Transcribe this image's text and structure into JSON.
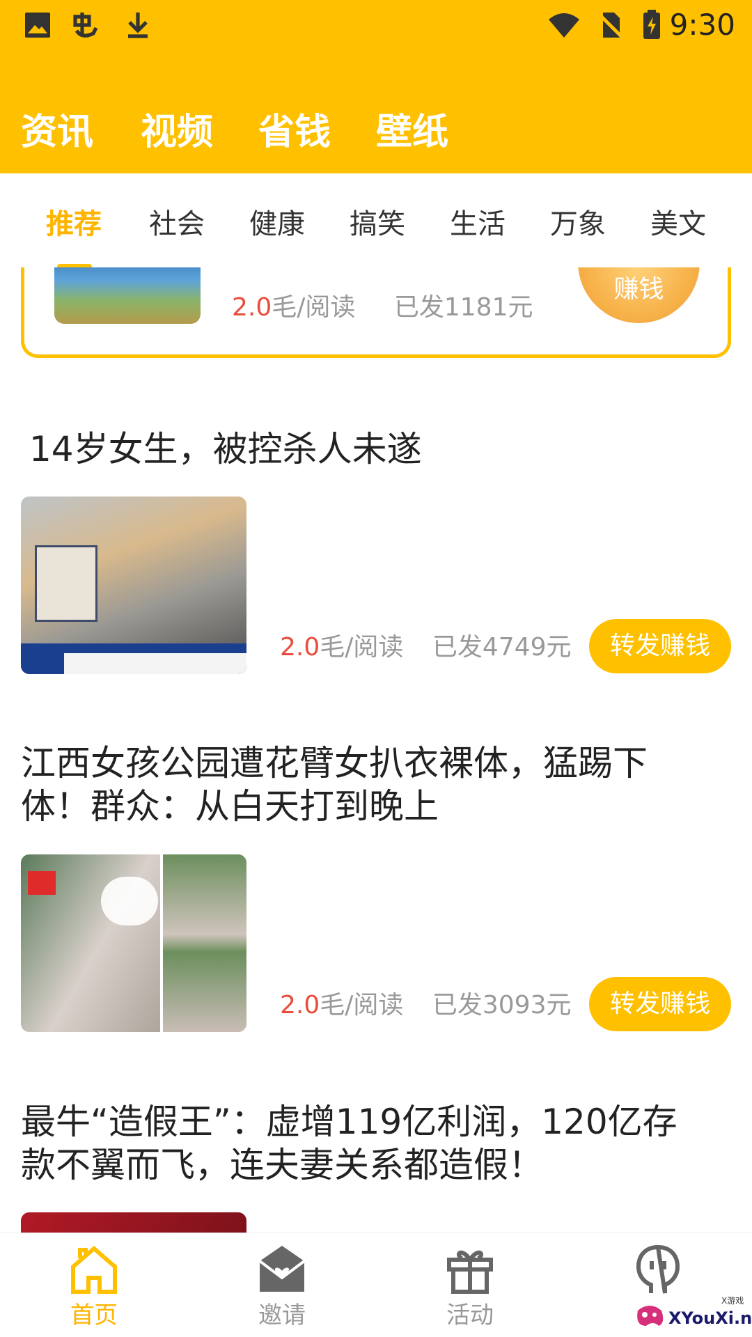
{
  "status_bar": {
    "time": "9:30",
    "icons": [
      "image-icon",
      "notification-app-icon",
      "download-icon",
      "wifi-icon",
      "no-sim-icon",
      "battery-charging-icon"
    ]
  },
  "top_tabs": [
    "资讯",
    "视频",
    "省钱",
    "壁纸"
  ],
  "category_tabs": [
    "推荐",
    "社会",
    "健康",
    "搞笑",
    "生活",
    "万象",
    "美文"
  ],
  "featured": {
    "rate_value": "2.0",
    "rate_unit": "毛/阅读",
    "paid": "已发1181元",
    "button": "赚钱"
  },
  "articles": [
    {
      "title": "14岁女生，被控杀人未遂",
      "rate_value": "2.0",
      "rate_unit": "毛/阅读",
      "paid": "已发4749元",
      "button": "转发赚钱"
    },
    {
      "title": "江西女孩公园遭花臂女扒衣裸体，猛踢下体！群众：从白天打到晚上",
      "rate_value": "2.0",
      "rate_unit": "毛/阅读",
      "paid": "已发3093元",
      "button": "转发赚钱"
    },
    {
      "title": "最牛“造假王”：虚增119亿利润，120亿存款不翼而飞，连夫妻关系都造假！"
    }
  ],
  "bottom_nav": [
    "首页",
    "邀请",
    "活动",
    ""
  ],
  "watermark": {
    "text": "XYouXi.net",
    "small": "X游戏"
  },
  "colors": {
    "brand": "#FFC000",
    "accent_text": "#FFB400",
    "rate_red": "#E84D3D"
  }
}
